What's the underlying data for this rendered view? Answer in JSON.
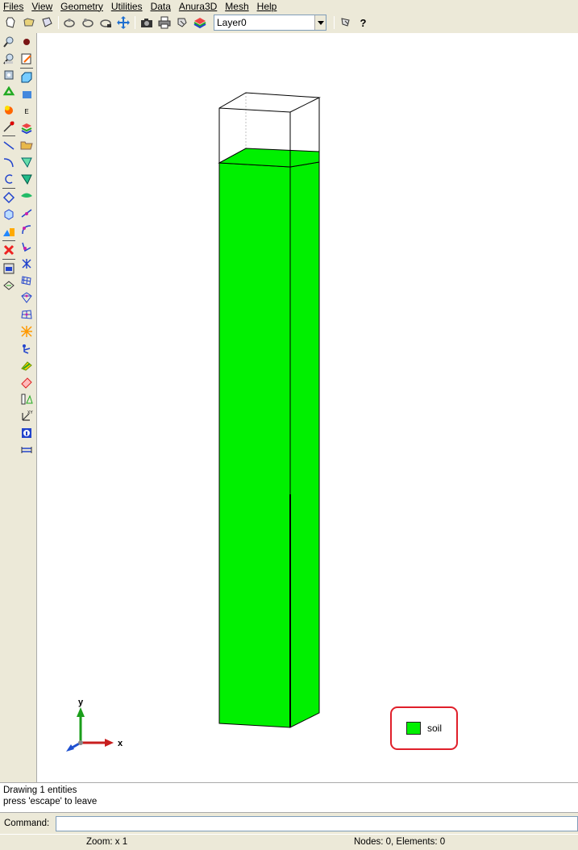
{
  "menu": [
    "Files",
    "View",
    "Geometry",
    "Utilities",
    "Data",
    "Anura3D",
    "Mesh",
    "Help"
  ],
  "toolbar": {
    "icons": [
      "new-icon",
      "open-icon",
      "save-icon",
      "zoom-frame-icon",
      "rotate-icon",
      "pan-icon",
      "move-icon",
      "camera-icon",
      "print-icon",
      "layer-manager-icon",
      "layers-icon"
    ],
    "layer_value": "Layer0",
    "help_icons": [
      "pointer-help-icon",
      "question-icon"
    ]
  },
  "viewport": {
    "model_color": "#00f000",
    "axis_x_label": "x",
    "axis_y_label": "y"
  },
  "legend": {
    "label": "soil",
    "color": "#00f000"
  },
  "status": {
    "line1": "Drawing 1 entities",
    "line2": "press 'escape' to leave"
  },
  "command": {
    "label": "Command:",
    "value": ""
  },
  "footer": {
    "zoom": "Zoom: x 1",
    "nodes": "Nodes: 0, Elements: 0"
  }
}
